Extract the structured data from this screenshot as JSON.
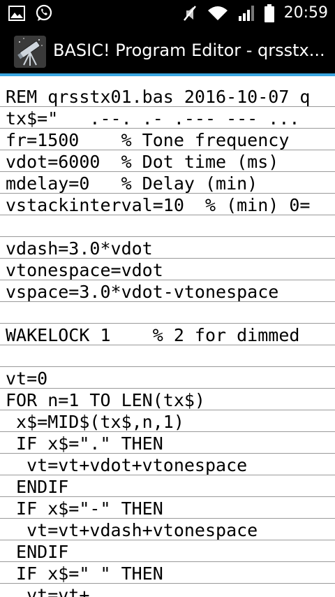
{
  "status_bar": {
    "time": "20:59",
    "icons": [
      "image-icon",
      "whatsapp-icon",
      "mute-icon",
      "wifi-icon",
      "signal-icon",
      "battery-icon"
    ]
  },
  "app_bar": {
    "title": "BASIC! Program Editor - qrsstx...",
    "icon": "telescope-app-icon",
    "accent_color": "#3aa6e0"
  },
  "editor": {
    "lines": [
      "REM qrsstx01.bas 2016-10-07 q",
      "tx$=\"___.--._.-_.---_---_...",
      "fr=1500    % Tone frequency",
      "vdot=6000  % Dot time (ms)",
      "mdelay=0   % Delay (min)",
      "vstackinterval=10  % (min) 0=",
      "",
      "vdash=3.0*vdot",
      "vtonespace=vdot",
      "vspace=3.0*vdot-vtonespace",
      "",
      "WAKELOCK 1    % 2 for dimmed",
      "",
      "vt=0",
      "FOR n=1 TO LEN(tx$)",
      " x$=MID$(tx$,n,1)",
      " IF x$=\".\" THEN",
      "  vt=vt+vdot+vtonespace",
      " ENDIF",
      " IF x$=\"-\" THEN",
      "  vt=vt+vdash+vtonespace",
      " ENDIF",
      " IF x$=\"_\" THEN",
      "  vt=vt+"
    ]
  }
}
